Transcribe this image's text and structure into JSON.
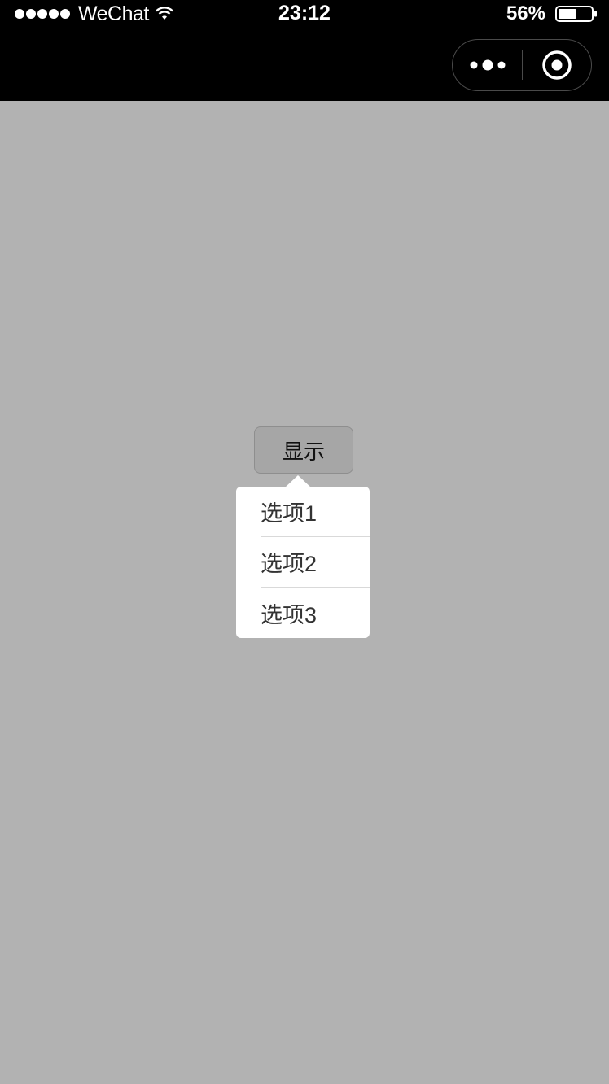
{
  "status_bar": {
    "carrier": "WeChat",
    "time": "23:12",
    "battery_percent": "56%",
    "battery_level": 0.56,
    "icons": [
      "signal-dots-icon",
      "wifi-icon",
      "battery-icon"
    ]
  },
  "nav_bar": {
    "capsule": {
      "more_icon": "more-dots-icon",
      "close_icon": "target-circle-icon"
    }
  },
  "main": {
    "button_label": "显示",
    "popover_items": [
      {
        "label": "选项1"
      },
      {
        "label": "选项2"
      },
      {
        "label": "选项3"
      }
    ]
  },
  "colors": {
    "background_mask": "#b2b2b2",
    "header": "#000000",
    "popover": "#ffffff"
  }
}
